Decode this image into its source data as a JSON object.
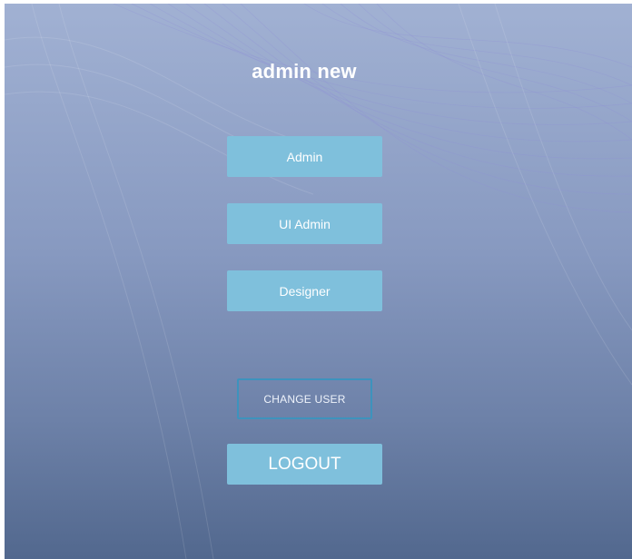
{
  "header": {
    "user_name": "admin new"
  },
  "roles": {
    "admin_label": "Admin",
    "ui_admin_label": "UI Admin",
    "designer_label": "Designer"
  },
  "actions": {
    "change_user_label": "CHANGE USER",
    "logout_label": "LOGOUT"
  },
  "colors": {
    "background_top": "#a1b1d3",
    "background_bottom": "#52688e",
    "button_fill": "#7fc0dc",
    "button_outline": "#3d93bd",
    "text": "#ffffff"
  }
}
